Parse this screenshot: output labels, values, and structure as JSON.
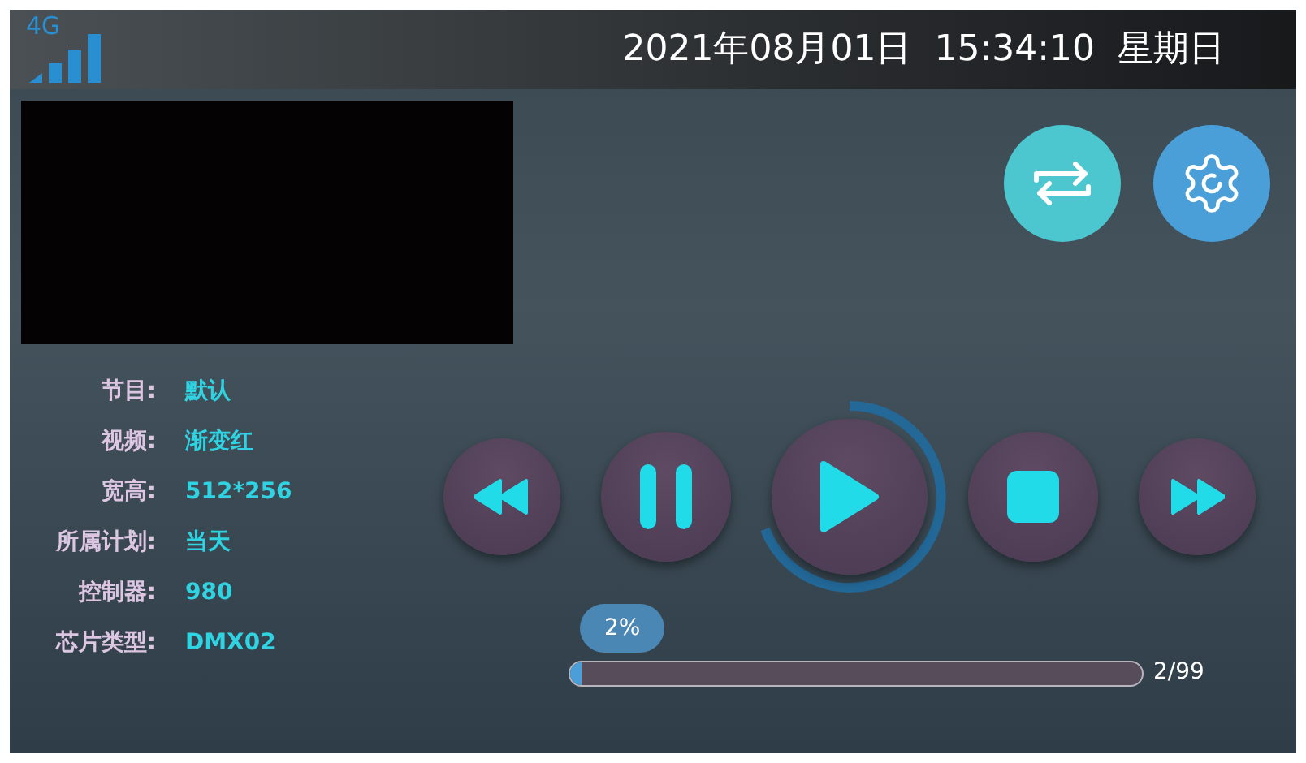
{
  "status_bar": {
    "network": "4G",
    "datetime": "2021年08月01日  15:34:10  星期日"
  },
  "top_buttons": [
    {
      "kind": "repeat"
    },
    {
      "kind": "settings"
    }
  ],
  "info": [
    {
      "label": "节目:",
      "value": "默认"
    },
    {
      "label": "视频:",
      "value": "渐变红"
    },
    {
      "label": "宽高:",
      "value": "512*256"
    },
    {
      "label": "所属计划:",
      "value": "当天"
    },
    {
      "label": "控制器:",
      "value": "980"
    },
    {
      "label": "芯片类型:",
      "value": "DMX02"
    }
  ],
  "controls": [
    {
      "kind": "rewind"
    },
    {
      "kind": "pause"
    },
    {
      "kind": "play"
    },
    {
      "kind": "stop"
    },
    {
      "kind": "forward"
    }
  ],
  "progress": {
    "level": 0.02,
    "percent": "2%",
    "count": "2/99"
  }
}
